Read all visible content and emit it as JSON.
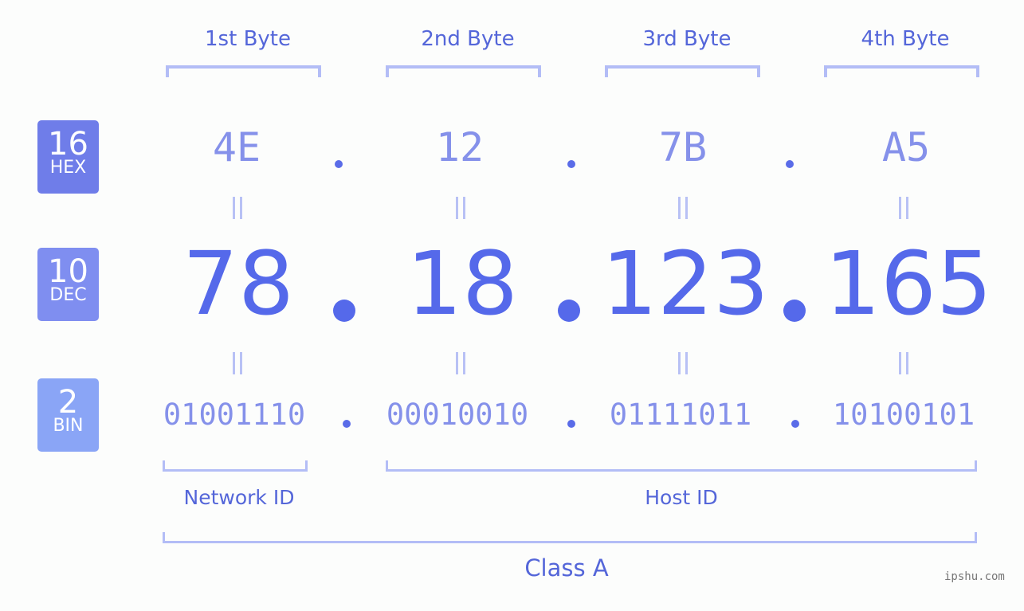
{
  "badges": [
    {
      "base": "16",
      "label": "HEX",
      "color": "#6f7de9"
    },
    {
      "base": "10",
      "label": "DEC",
      "color": "#7f8ef0"
    },
    {
      "base": "2",
      "label": "BIN",
      "color": "#8aa5f6"
    }
  ],
  "byte_labels": [
    "1st Byte",
    "2nd Byte",
    "3rd Byte",
    "4th Byte"
  ],
  "hex": [
    "4E",
    "12",
    "7B",
    "A5"
  ],
  "dec": [
    "78",
    "18",
    "123",
    "165"
  ],
  "bin": [
    "01001110",
    "00010010",
    "01111011",
    "10100101"
  ],
  "groups": {
    "network": "Network ID",
    "host": "Host ID",
    "class": "Class A"
  },
  "watermark": "ipshu.com",
  "colors": {
    "accent": "#5569ea",
    "light": "#8591ea",
    "bracket": "#b3bdf6"
  }
}
